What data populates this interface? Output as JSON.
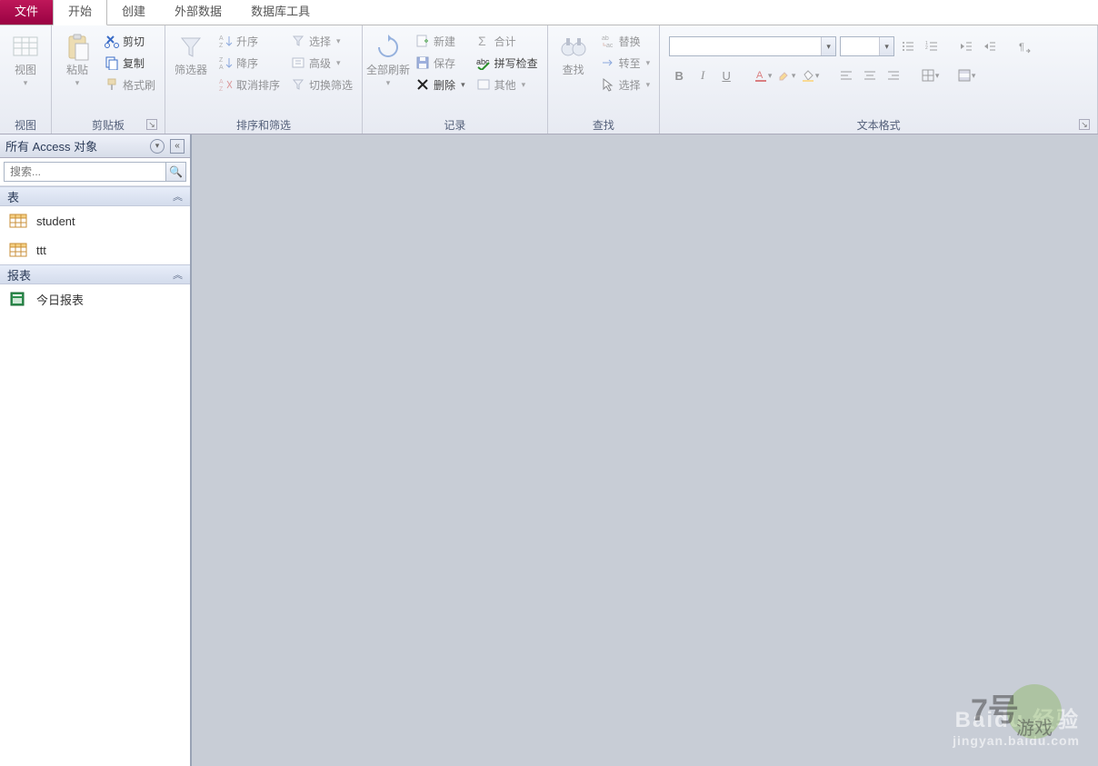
{
  "tabs": {
    "file": "文件",
    "home": "开始",
    "create": "创建",
    "external": "外部数据",
    "dbtools": "数据库工具"
  },
  "ribbon": {
    "view": {
      "label": "视图",
      "group_title": "视图"
    },
    "clipboard": {
      "paste": "粘贴",
      "cut": "剪切",
      "copy": "复制",
      "format_painter": "格式刷",
      "group_title": "剪贴板"
    },
    "sort_filter": {
      "filter": "筛选器",
      "asc": "升序",
      "desc": "降序",
      "clear_sort": "取消排序",
      "selection": "选择",
      "advanced": "高级",
      "toggle_filter": "切换筛选",
      "group_title": "排序和筛选"
    },
    "records": {
      "refresh_all": "全部刷新",
      "new": "新建",
      "save": "保存",
      "delete": "删除",
      "totals": "合计",
      "spellcheck": "拼写检查",
      "more": "其他",
      "group_title": "记录"
    },
    "find": {
      "find": "查找",
      "replace": "替换",
      "goto": "转至",
      "select": "选择",
      "group_title": "查找"
    },
    "text_format": {
      "group_title": "文本格式"
    }
  },
  "sidebar": {
    "title": "所有 Access 对象",
    "search_placeholder": "搜索...",
    "cat_tables": "表",
    "cat_reports": "报表",
    "tables": [
      {
        "name": "student"
      },
      {
        "name": "ttt"
      }
    ],
    "reports": [
      {
        "name": "今日报表"
      }
    ]
  },
  "watermark": {
    "line1": "Baidu 经验",
    "line2": "jingyan.baidu.com"
  }
}
